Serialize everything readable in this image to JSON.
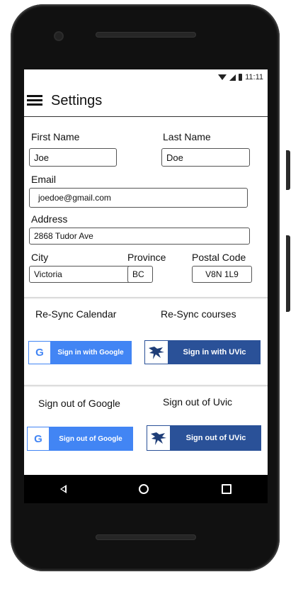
{
  "status": {
    "time": "11:11"
  },
  "appbar": {
    "title": "Settings"
  },
  "form": {
    "first_name_label": "First Name",
    "first_name_value": "Joe",
    "last_name_label": "Last Name",
    "last_name_value": "Doe",
    "email_label": "Email",
    "email_value": "joedoe@gmail.com",
    "address_label": "Address",
    "address_value": "2868 Tudor Ave",
    "city_label": "City",
    "city_value": "Victoria",
    "province_label": "Province",
    "province_value": "BC",
    "postal_label": "Postal Code",
    "postal_value": "V8N 1L9"
  },
  "resync": {
    "calendar_label": "Re-Sync Calendar",
    "courses_label": "Re-Sync courses",
    "google_button": "Sign in with Google",
    "uvic_button": "Sign in with UVic"
  },
  "signout": {
    "google_label": "Sign out of Google",
    "uvic_label": "Sign out of Uvic",
    "google_button": "Sign out of Google",
    "uvic_button": "Sign out of UVic"
  },
  "colors": {
    "google_blue": "#4285F4",
    "uvic_blue": "#2a5198"
  },
  "icons": {
    "google": "google-g-icon",
    "uvic": "uvic-bird-icon"
  }
}
